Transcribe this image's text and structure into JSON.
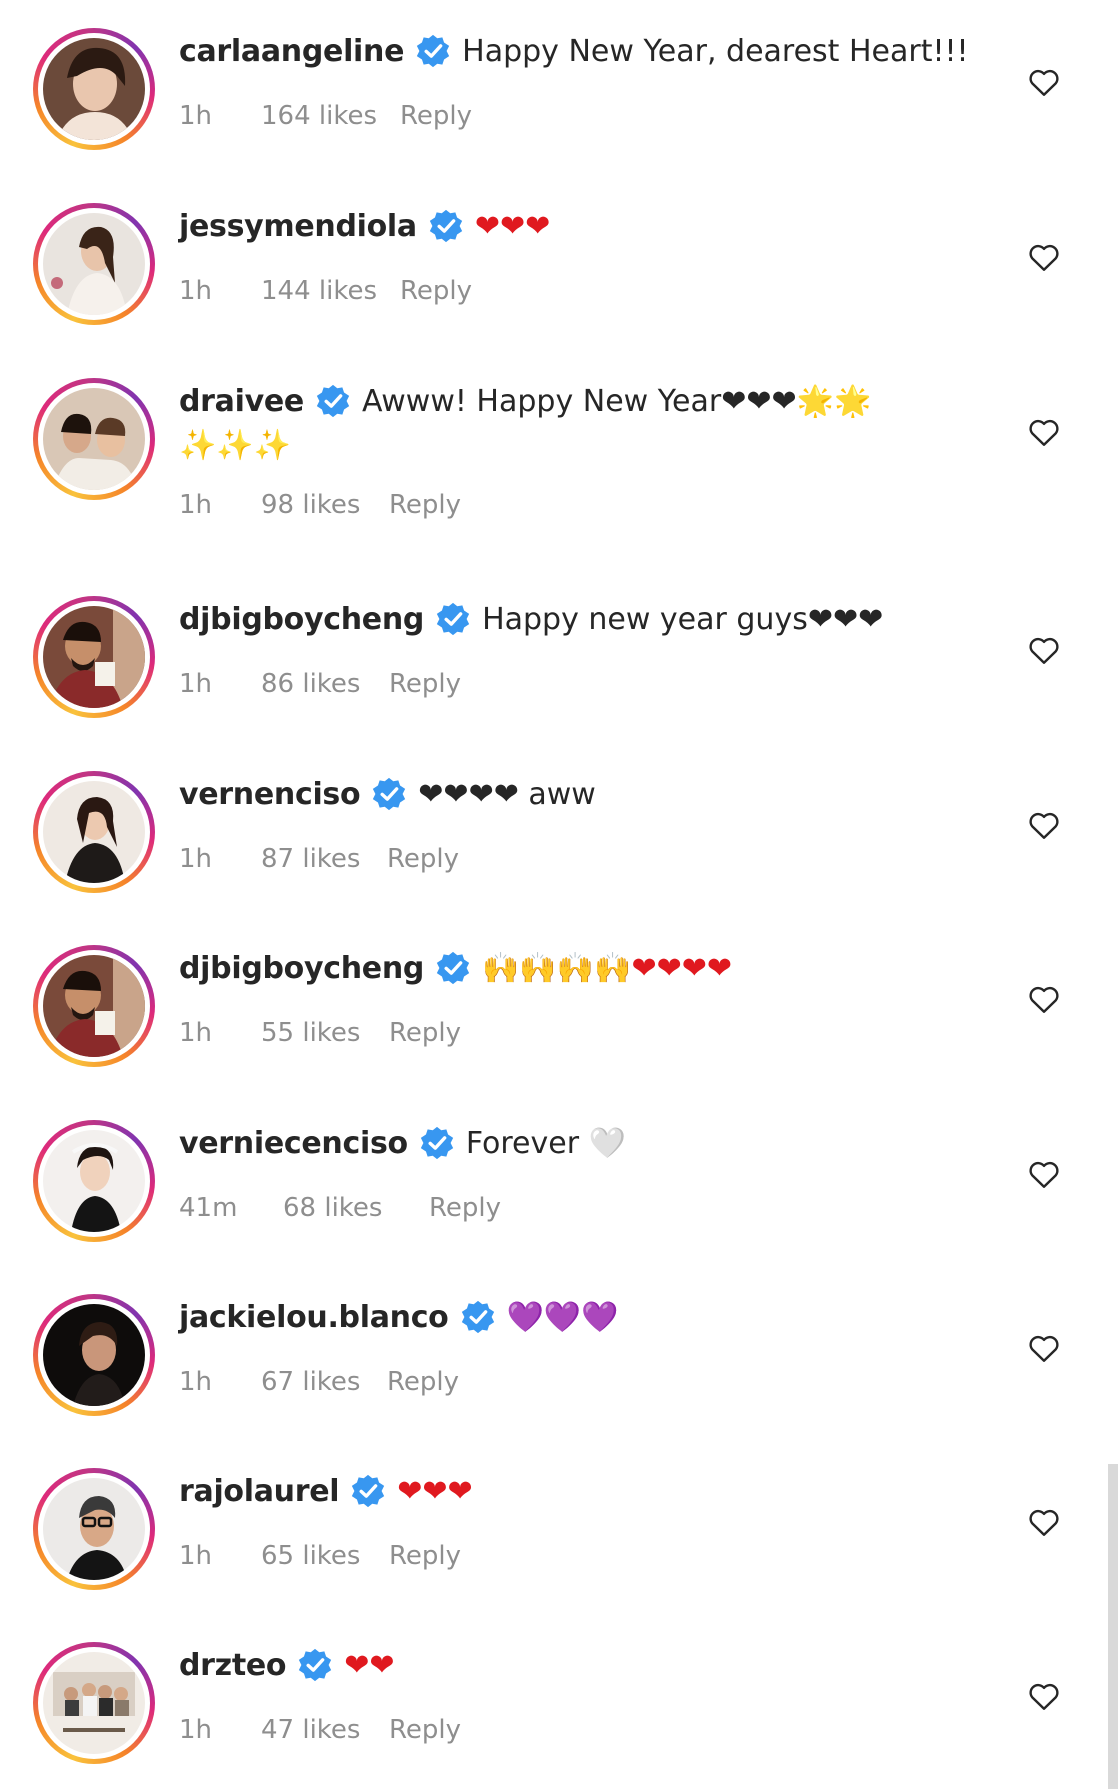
{
  "comments": [
    {
      "username": "carlaangeline",
      "text": "Happy New Year, dearest Heart!!!",
      "text_line2": "",
      "time": "1h",
      "likes": "164 likes",
      "reply": "Reply"
    },
    {
      "username": "jessymendiola",
      "text": "❤❤❤",
      "text_line2": "",
      "time": "1h",
      "likes": "144 likes",
      "reply": "Reply"
    },
    {
      "username": "draivee",
      "text": "Awww! Happy New Year❤❤❤🌟🌟",
      "text_line2": "✨✨✨",
      "time": "1h",
      "likes": "98 likes",
      "reply": "Reply"
    },
    {
      "username": "djbigboycheng",
      "text": "Happy new year guys❤❤❤",
      "text_line2": "",
      "time": "1h",
      "likes": "86 likes",
      "reply": "Reply"
    },
    {
      "username": "vernenciso",
      "text": "❤❤❤❤ aww",
      "text_line2": "",
      "time": "1h",
      "likes": "87 likes",
      "reply": "Reply"
    },
    {
      "username": "djbigboycheng",
      "text": "🙌🙌🙌🙌❤❤❤❤",
      "text_line2": "",
      "time": "1h",
      "likes": "55 likes",
      "reply": "Reply"
    },
    {
      "username": "verniecenciso",
      "text": "Forever 🤍",
      "text_line2": "",
      "time": "41m",
      "likes": "68 likes",
      "reply": "Reply"
    },
    {
      "username": "jackielou.blanco",
      "text": "💜💜💜",
      "text_line2": "",
      "time": "1h",
      "likes": "67 likes",
      "reply": "Reply"
    },
    {
      "username": "rajolaurel",
      "text": "❤❤❤",
      "text_line2": "",
      "time": "1h",
      "likes": "65 likes",
      "reply": "Reply"
    },
    {
      "username": "drzteo",
      "text": "❤❤",
      "text_line2": "",
      "time": "1h",
      "likes": "47 likes",
      "reply": "Reply"
    }
  ],
  "icons": {
    "verified": "verified-badge-icon",
    "like": "heart-outline-icon"
  },
  "colors": {
    "verified_blue": "#3897f0",
    "meta_gray": "#8e8e8e",
    "heart_red": "#e0191f"
  }
}
